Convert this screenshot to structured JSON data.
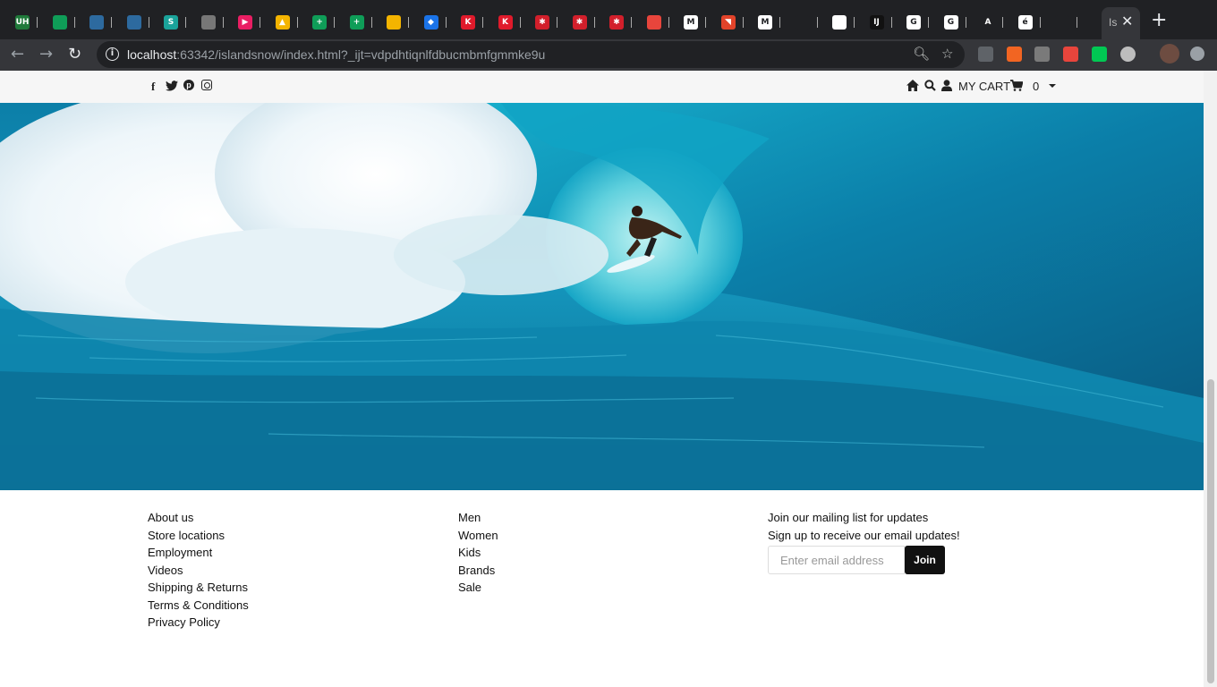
{
  "browser": {
    "tabs": [
      {
        "icon": "uh-icon",
        "letter": "UH",
        "color": "#1f7a3a"
      },
      {
        "icon": "leaf-icon",
        "letter": "",
        "color": "#0f9d58"
      },
      {
        "icon": "square-icon",
        "letter": "",
        "color": "#2d6a9f"
      },
      {
        "icon": "square-icon",
        "letter": "",
        "color": "#2d6a9f"
      },
      {
        "icon": "s-icon",
        "letter": "S",
        "color": "#1aa39a"
      },
      {
        "icon": "book-icon",
        "letter": "",
        "color": "#777777"
      },
      {
        "icon": "play-icon",
        "letter": "▶",
        "color": "#e91e63"
      },
      {
        "icon": "drive-icon",
        "letter": "▲",
        "color": "#f4b400"
      },
      {
        "icon": "sheet-icon",
        "letter": "+",
        "color": "#0f9d58"
      },
      {
        "icon": "sheet-icon",
        "letter": "+",
        "color": "#0f9d58"
      },
      {
        "icon": "slides-icon",
        "letter": "",
        "color": "#f4b400"
      },
      {
        "icon": "diamond-icon",
        "letter": "◆",
        "color": "#1a73e8"
      },
      {
        "icon": "k-icon",
        "letter": "K",
        "color": "#e01a2b"
      },
      {
        "icon": "k-icon",
        "letter": "K",
        "color": "#e01a2b"
      },
      {
        "icon": "gear-red-icon",
        "letter": "✱",
        "color": "#d21f2b"
      },
      {
        "icon": "gear-red-icon",
        "letter": "✱",
        "color": "#d21f2b"
      },
      {
        "icon": "gear-red-icon",
        "letter": "✱",
        "color": "#d21f2b"
      },
      {
        "icon": "chip-icon",
        "letter": "",
        "color": "#e8453c"
      },
      {
        "icon": "m-icon",
        "letter": "M",
        "color": "#ffffff"
      },
      {
        "icon": "gitlab-icon",
        "letter": "◥",
        "color": "#e2432a"
      },
      {
        "icon": "medium-icon",
        "letter": "M",
        "color": "#ffffff"
      },
      {
        "icon": "github-icon",
        "letter": "",
        "color": "#202124"
      },
      {
        "icon": "globe-icon",
        "letter": "",
        "color": "#ffffff"
      },
      {
        "icon": "intellij-icon",
        "letter": "IJ",
        "color": "#111111"
      },
      {
        "icon": "google-icon",
        "letter": "G",
        "color": "#ffffff"
      },
      {
        "icon": "google-icon",
        "letter": "G",
        "color": "#ffffff"
      },
      {
        "icon": "angle-icon",
        "letter": "A",
        "color": "#202124"
      },
      {
        "icon": "e-icon",
        "letter": "é",
        "color": "#ffffff"
      },
      {
        "icon": "github-icon",
        "letter": "",
        "color": "#202124"
      }
    ],
    "active_tab_letter": "Is",
    "url_host": "localhost",
    "url_rest": ":63342/islandsnow/index.html?_ijt=vdpdhtiqnlfdbucmbmfgmmke9u"
  },
  "store": {
    "social": [
      "facebook-icon",
      "twitter-icon",
      "pinterest-icon",
      "instagram-icon"
    ],
    "cart_label": "MY CART",
    "cart_count": "0"
  },
  "footer": {
    "links_col1": [
      "About us",
      "Store locations",
      "Employment",
      "Videos",
      "Shipping & Returns",
      "Terms & Conditions",
      "Privacy Policy"
    ],
    "links_col2": [
      "Men",
      "Women",
      "Kids",
      "Brands",
      "Sale"
    ],
    "mailing_title": "Join our mailing list for updates",
    "mailing_subtitle": "Sign up to receive our email updates!",
    "email_placeholder": "Enter email address",
    "join_label": "Join"
  },
  "colors": {
    "ocean_deep": "#0b6f9c",
    "ocean_bright": "#1fa6c9",
    "foam": "#f3f8fb",
    "button": "#111111"
  }
}
